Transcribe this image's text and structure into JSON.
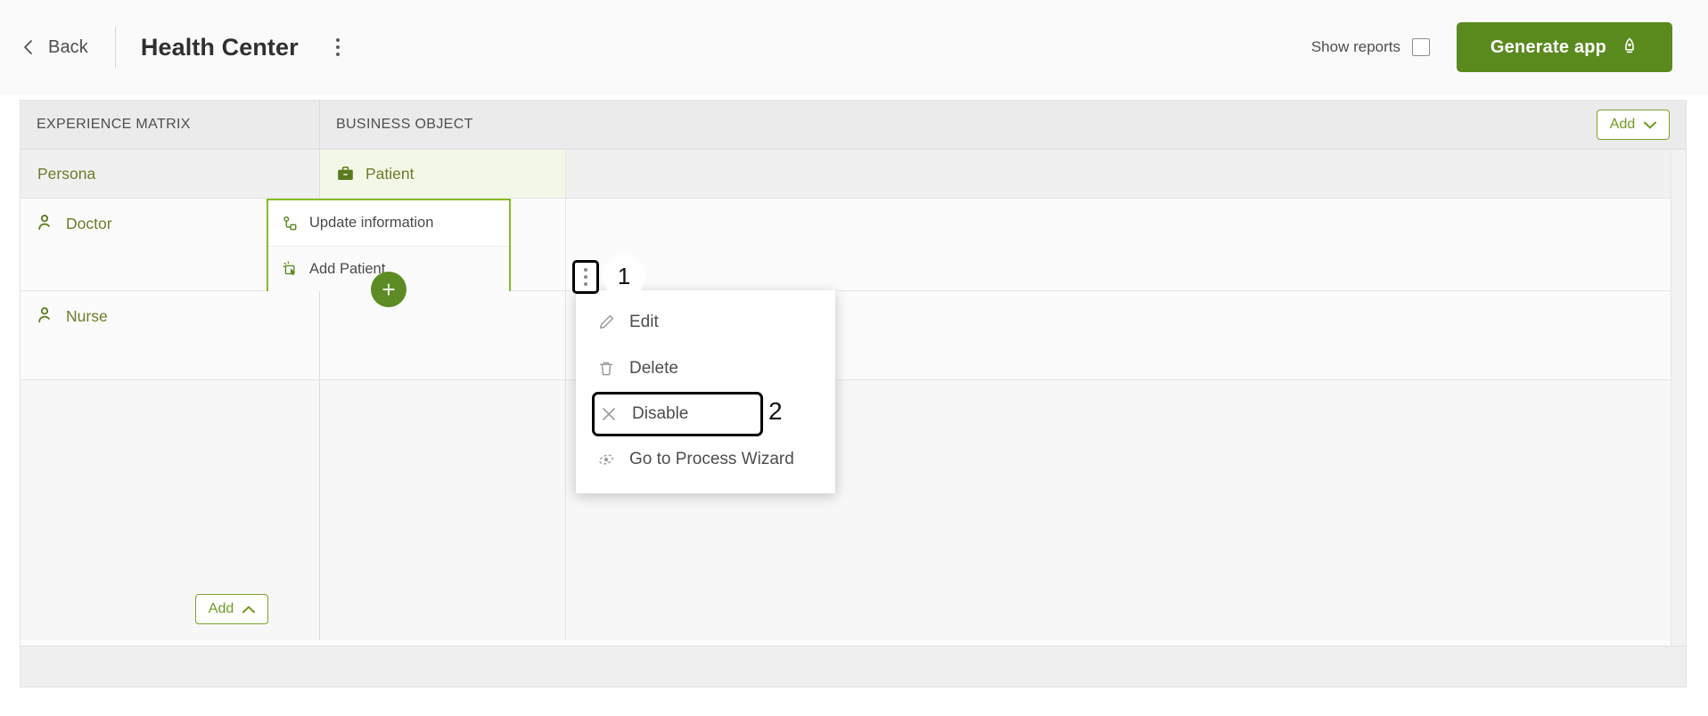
{
  "header": {
    "back_label": "Back",
    "title": "Health Center",
    "overflow_icon": "kebab-menu-icon",
    "show_reports_label": "Show reports",
    "show_reports_checked": false,
    "generate_button_label": "Generate app",
    "generate_button_icon": "rocket-icon",
    "accent_green": "#5a8a1e"
  },
  "matrix": {
    "columns": [
      {
        "id": "experience-matrix",
        "label": "EXPERIENCE MATRIX"
      },
      {
        "id": "business-object",
        "label": "BUSINESS OBJECT"
      }
    ],
    "add_top": {
      "label": "Add",
      "chevron": "chevron-down-icon"
    },
    "add_bottom": {
      "label": "Add",
      "chevron": "chevron-up-icon"
    },
    "persona_row": {
      "label": "Persona",
      "object": {
        "label": "Patient",
        "icon": "briefcase-icon"
      }
    },
    "rows": [
      {
        "label": "Doctor",
        "icon": "person-icon"
      },
      {
        "label": "Nurse",
        "icon": "person-icon"
      }
    ],
    "selected_cell": {
      "items": [
        {
          "label": "Update information",
          "icon": "process-node-icon"
        },
        {
          "label": "Add Patient",
          "icon": "cursor-click-icon"
        }
      ],
      "add_item_button": "+",
      "border_color": "#86bc25"
    }
  },
  "annotations": [
    {
      "id": "1",
      "label": "1",
      "target": "kebab-menu-button"
    },
    {
      "id": "2",
      "label": "2",
      "target": "menu-item-disable"
    }
  ],
  "context_menu": {
    "items": [
      {
        "label": "Edit",
        "icon": "pencil-icon",
        "highlighted": false
      },
      {
        "label": "Delete",
        "icon": "trash-icon",
        "highlighted": false
      },
      {
        "label": "Disable",
        "icon": "close-x-icon",
        "highlighted": true
      },
      {
        "label": "Go to Process Wizard",
        "icon": "process-wizard-icon",
        "highlighted": false
      }
    ]
  }
}
